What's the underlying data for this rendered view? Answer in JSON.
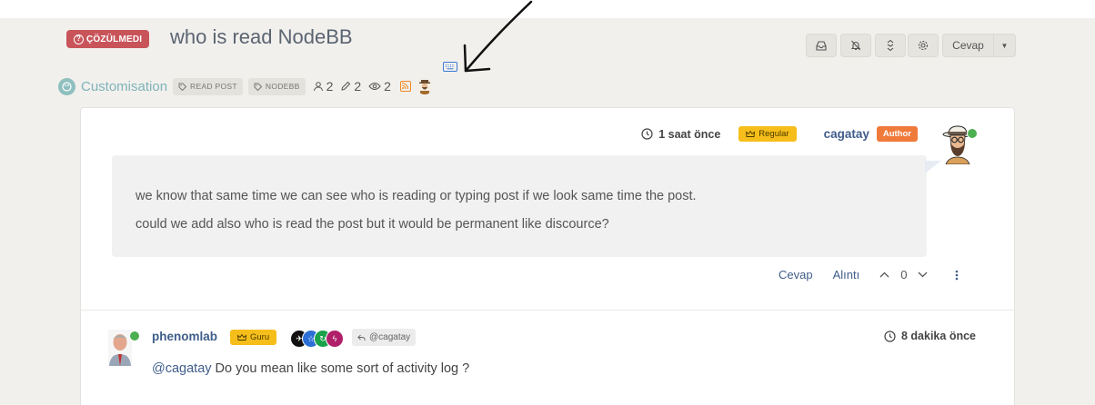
{
  "topic": {
    "status": "ÇÖZÜLMEDI",
    "title": "who is read NodeBB",
    "category": "Customisation",
    "tags": [
      "READ POST",
      "NODEBB"
    ],
    "stats": {
      "posters": "2",
      "posts": "2",
      "views": "2"
    }
  },
  "toolbar": {
    "reply_label": "Cevap"
  },
  "posts": [
    {
      "time": "1 saat önce",
      "role": "Regular",
      "username": "cagatay",
      "author_label": "Author",
      "lines": [
        "we know that same time we can see who is reading or typing post if we look same time the post.",
        "could we add also who is read the post but it would be permanent like discource?"
      ],
      "actions": {
        "reply": "Cevap",
        "quote": "Alıntı",
        "votes": "0"
      }
    },
    {
      "username": "phenomlab",
      "role": "Guru",
      "reply_to": "@cagatay",
      "time": "8 dakika önce",
      "mention": "@cagatay",
      "text": " Do you mean like some sort of activity log ?"
    }
  ],
  "colors": {
    "status_badge": "#c8545a",
    "category": "#7fb3b8",
    "role_badge": "#f6be1a",
    "author_badge": "#f07a3a",
    "link": "#3f5d8a",
    "online": "#4caf50"
  }
}
